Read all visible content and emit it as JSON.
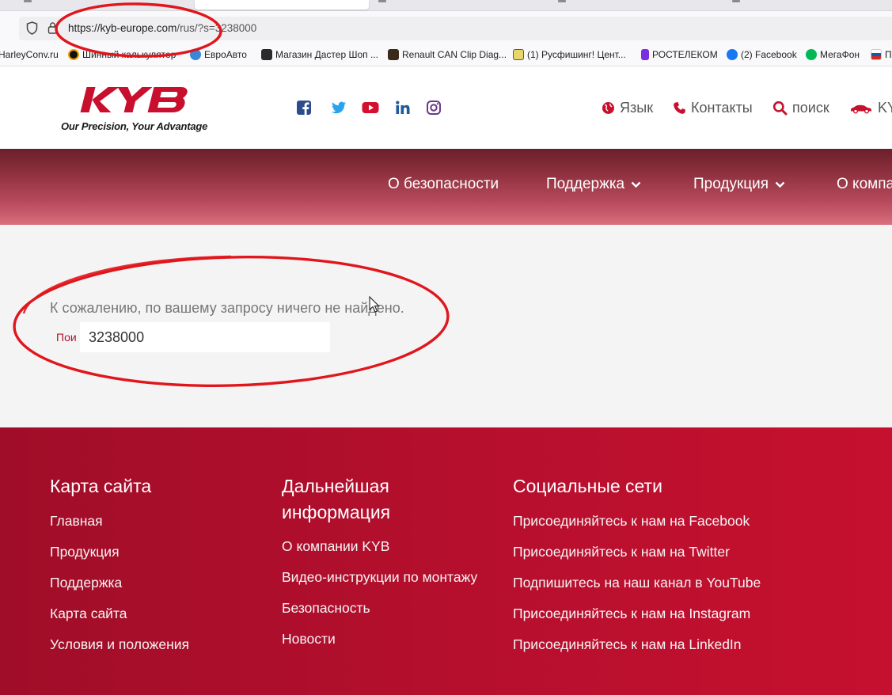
{
  "browser": {
    "url_host": "https://kyb-europe.com",
    "url_path": "/rus/?s=3238000",
    "bookmarks": [
      {
        "label": "HarleyConv.ru",
        "color": "#ffffff"
      },
      {
        "label": "Шинный калькулятор",
        "color": "#111111"
      },
      {
        "label": "ЕвроАвто",
        "color": "#3a86d9"
      },
      {
        "label": "Магазин Дастер Шоп ...",
        "color": "#2a2a2a"
      },
      {
        "label": "Renault CAN Clip Diag...",
        "color": "#3b2a1a"
      },
      {
        "label": "(1) Русфишинг! Цент...",
        "color": "#e9d66b"
      },
      {
        "label": "РОСТЕЛЕКОМ",
        "color": "#7b2ee0"
      },
      {
        "label": "(2) Facebook",
        "color": "#1877f2"
      },
      {
        "label": "МегаФон",
        "color": "#00b956"
      },
      {
        "label": "П",
        "color": "#d52b1e"
      }
    ]
  },
  "header": {
    "tagline": "Our Precision, Your Advantage",
    "social_icons": [
      "facebook-icon",
      "twitter-icon",
      "youtube-icon",
      "linkedin-icon",
      "instagram-icon"
    ],
    "utility": {
      "language": "Язык",
      "contacts": "Контакты",
      "search": "поиск",
      "kyb": "KY"
    },
    "brand_color": "#c8102e"
  },
  "nav": {
    "items": [
      {
        "label": "О безопасности"
      },
      {
        "label": "Поддержка"
      },
      {
        "label": "Продукция"
      },
      {
        "label": "О компа"
      }
    ]
  },
  "content": {
    "message": "К сожалению, по вашему запросу ничего не найдено.",
    "search_label": "Пои",
    "search_value": "3238000"
  },
  "footer": {
    "columns": [
      {
        "heading_line1": "Карта сайта",
        "links": [
          "Главная",
          "Продукция",
          "Поддержка",
          "Карта сайта",
          "Условия и положения"
        ]
      },
      {
        "heading_line1": "Дальнейшая",
        "heading_line2": "информация",
        "links": [
          "О компании KYB",
          "Видео-инструкции по монтажу",
          "Безопасность",
          "Новости"
        ]
      },
      {
        "heading_line1": "Социальные сети",
        "links": [
          "Присоединяйтесь к нам на Facebook",
          "Присоединяйтесь к нам на Twitter",
          "Подпишитесь на наш канал в YouTube",
          "Присоединяйтесь к нам на Instagram",
          "Присоединяйтесь к нам на LinkedIn"
        ]
      }
    ]
  }
}
